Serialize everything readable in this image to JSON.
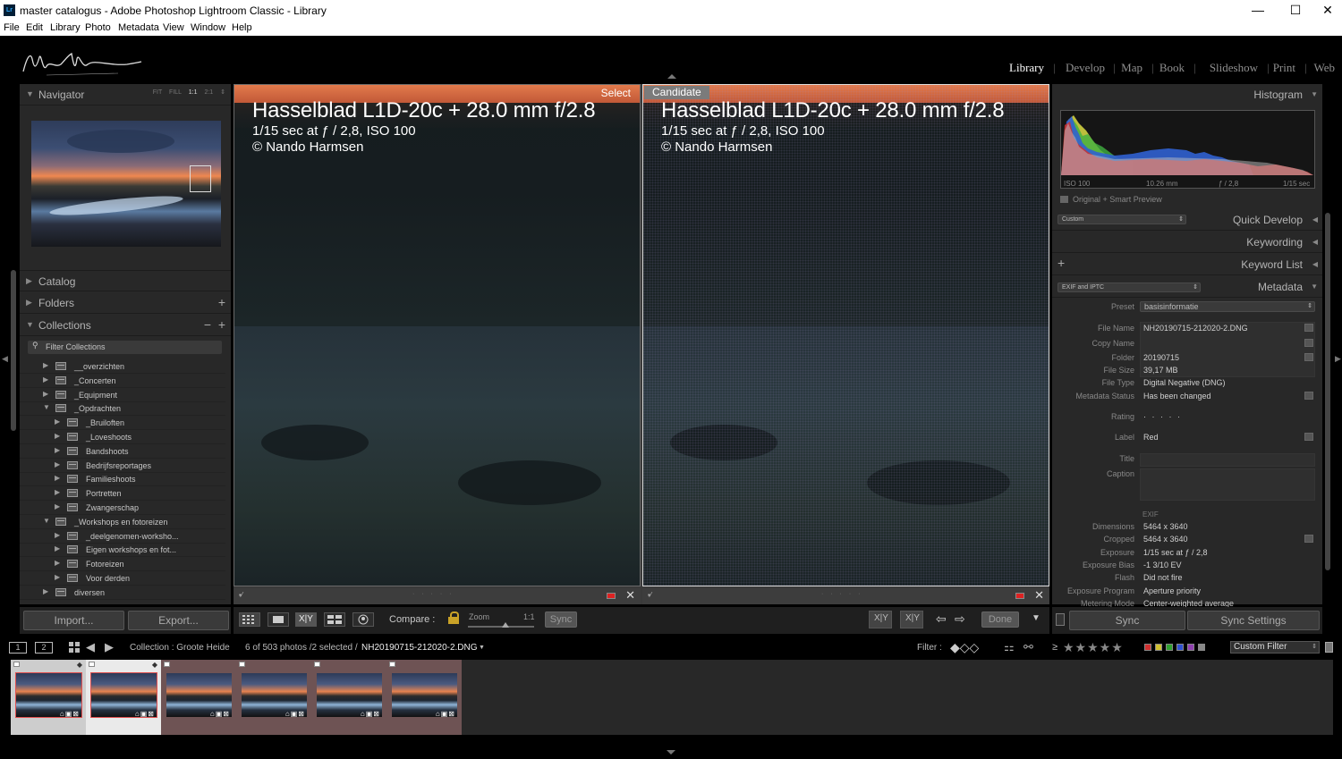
{
  "window": {
    "title": "master catalogus - Adobe Photoshop Lightroom Classic - Library",
    "app_icon": "Lr",
    "controls": [
      "—",
      "☐",
      "✕"
    ]
  },
  "menu": [
    "File",
    "Edit",
    "Library",
    "Photo",
    "Metadata",
    "View",
    "Window",
    "Help"
  ],
  "modules": {
    "items": [
      "Library",
      "Develop",
      "Map",
      "Book",
      "Slideshow",
      "Print",
      "Web"
    ],
    "active": "Library",
    "separator": "|"
  },
  "left_panel": {
    "navigator": {
      "title": "Navigator",
      "options": [
        "FIT",
        "FILL",
        "1:1",
        "2:1"
      ],
      "active_option": "1:1"
    },
    "catalog": "Catalog",
    "folders": "Folders",
    "collections": "Collections",
    "filter_placeholder": "Filter Collections",
    "collection_tree": [
      {
        "name": "__overzichten",
        "level": 0,
        "open": false
      },
      {
        "name": "_Concerten",
        "level": 0,
        "open": false
      },
      {
        "name": "_Equipment",
        "level": 0,
        "open": false
      },
      {
        "name": "_Opdrachten",
        "level": 0,
        "open": true
      },
      {
        "name": "_Bruiloften",
        "level": 1,
        "open": false
      },
      {
        "name": "_Loveshoots",
        "level": 1,
        "open": false
      },
      {
        "name": "Bandshoots",
        "level": 1,
        "open": false
      },
      {
        "name": "Bedrijfsreportages",
        "level": 1,
        "open": false
      },
      {
        "name": "Familieshoots",
        "level": 1,
        "open": false
      },
      {
        "name": "Portretten",
        "level": 1,
        "open": false
      },
      {
        "name": "Zwangerschap",
        "level": 1,
        "open": false
      },
      {
        "name": "_Workshops en fotoreizen",
        "level": 0,
        "open": true
      },
      {
        "name": "_deelgenomen-worksho...",
        "level": 1,
        "open": false
      },
      {
        "name": "Eigen workshops en fot...",
        "level": 1,
        "open": false
      },
      {
        "name": "Fotoreizen",
        "level": 1,
        "open": false
      },
      {
        "name": "Voor derden",
        "level": 1,
        "open": false
      },
      {
        "name": "diversen",
        "level": 0,
        "open": false
      }
    ],
    "import_label": "Import...",
    "export_label": "Export..."
  },
  "compare": {
    "select_tag": "Select",
    "candidate_tag": "Candidate",
    "overlay_line1": "Hasselblad L1D-20c + 28.0 mm f/2.8",
    "overlay_line2": "1/15 sec at ƒ / 2,8, ISO 100",
    "overlay_line3": "© Nando Harmsen",
    "rating_dots": "· · · · ·",
    "close": "✕"
  },
  "toolbar": {
    "compare_label": "Compare :",
    "zoom_label": "Zoom",
    "zoom_value": "1:1",
    "sync_label": "Sync",
    "done_label": "Done",
    "xy_label": "X|Y"
  },
  "right_panel": {
    "histogram": {
      "title": "Histogram",
      "iso": "ISO 100",
      "focal": "10.26 mm",
      "aperture": "ƒ / 2,8",
      "shutter": "1/15 sec"
    },
    "original_smart": "Original + Smart Preview",
    "quick_develop": {
      "title": "Quick Develop",
      "preset": "Custom"
    },
    "keywording": "Keywording",
    "keyword_list": "Keyword List",
    "metadata": {
      "title": "Metadata",
      "view": "EXIF and IPTC",
      "preset_label": "Preset",
      "preset_value": "basisinformatie",
      "fields": [
        {
          "key": "File Name",
          "value": "NH20190715-212020-2.DNG"
        },
        {
          "key": "Copy Name",
          "value": ""
        },
        {
          "key": "Folder",
          "value": "20190715"
        },
        {
          "key": "File Size",
          "value": "39,17 MB"
        },
        {
          "key": "File Type",
          "value": "Digital Negative (DNG)"
        },
        {
          "key": "Metadata Status",
          "value": "Has been changed"
        }
      ],
      "rating_label": "Rating",
      "rating_value": "· · · · ·",
      "label_label": "Label",
      "label_value": "Red",
      "title_label": "Title",
      "caption_label": "Caption",
      "exif_heading": "EXIF",
      "exif": [
        {
          "key": "Dimensions",
          "value": "5464 x 3640"
        },
        {
          "key": "Cropped",
          "value": "5464 x 3640"
        },
        {
          "key": "Exposure",
          "value": "1/15 sec at ƒ / 2,8"
        },
        {
          "key": "Exposure Bias",
          "value": "-1 3/10 EV"
        },
        {
          "key": "Flash",
          "value": "Did not fire"
        },
        {
          "key": "Exposure Program",
          "value": "Aperture priority"
        },
        {
          "key": "Metering Mode",
          "value": "Center-weighted average"
        }
      ]
    },
    "sync_label": "Sync",
    "sync_settings_label": "Sync Settings"
  },
  "filmstrip_header": {
    "monitor1": "1",
    "monitor2": "2",
    "collection": "Collection : Groote Heide",
    "count": "6 of 503 photos /2 selected /",
    "filename": "NH20190715-212020-2.DNG",
    "filter_label": "Filter :",
    "gte": "≥",
    "stars": "★★★★★",
    "custom_filter": "Custom Filter",
    "label_colors": [
      "#d03030",
      "#d0c030",
      "#30a030",
      "#3050d0",
      "#9040b0",
      "#888888"
    ]
  },
  "filmstrip": {
    "count": 6,
    "selected": [
      0,
      1
    ],
    "active": 1,
    "badges": "⌂▣⊠"
  }
}
